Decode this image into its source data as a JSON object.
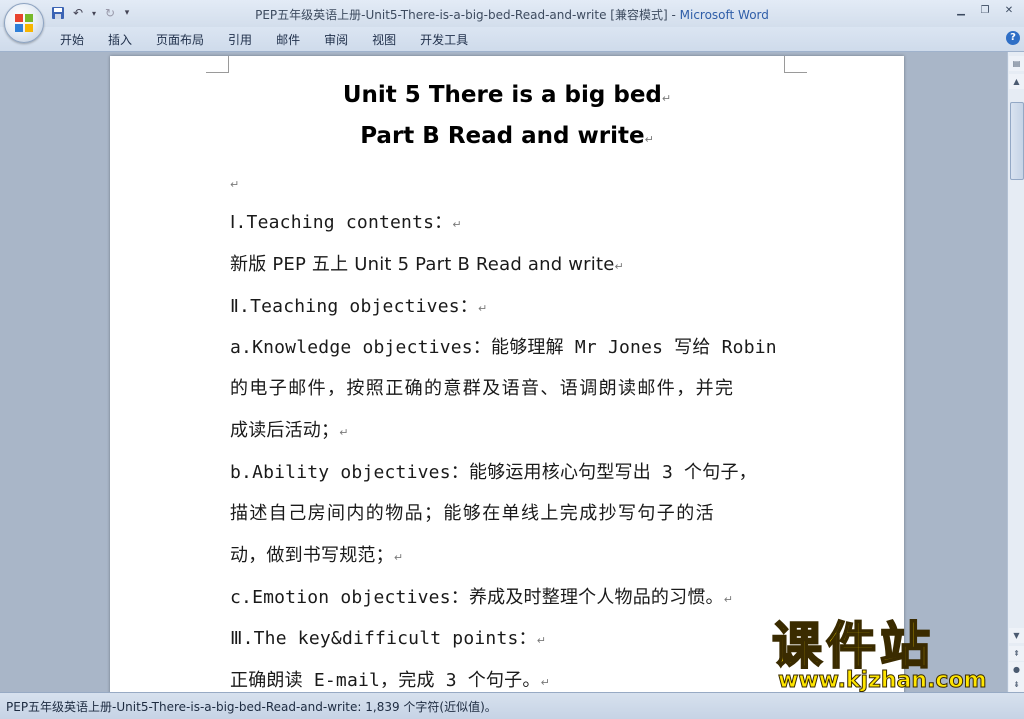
{
  "window": {
    "title": "PEP五年级英语上册-Unit5-There-is-a-big-bed-Read-and-write [兼容模式]",
    "title_separator": " - ",
    "app_name": "Microsoft Word",
    "min": "▁",
    "restore": "❐",
    "close": "✕"
  },
  "ribbon": {
    "tabs": [
      "开始",
      "插入",
      "页面布局",
      "引用",
      "邮件",
      "审阅",
      "视图",
      "开发工具"
    ],
    "help": "?"
  },
  "document": {
    "heading1": "Unit 5 There is a big bed",
    "heading2": "Part B Read and write",
    "para_mark": "↵",
    "lines": [
      "Ⅰ.Teaching contents：",
      "新版 PEP 五上  Unit 5 Part B Read and write",
      "Ⅱ.Teaching objectives：",
      "a.Knowledge objectives：能够理解 Mr Jones 写给 Robin",
      "的电子邮件，按照正确的意群及语音、语调朗读邮件，并完",
      "成读后活动；",
      "b.Ability objectives：能够运用核心句型写出 3 个句子，",
      "描述自己房间内的物品；能够在单线上完成抄写句子的活",
      "动，做到书写规范；",
      "c.Emotion objectives：养成及时整理个人物品的习惯。",
      "Ⅲ.The key&difficult points：",
      "正确朗读 E-mail，完成 3 个句子。"
    ]
  },
  "statusbar": {
    "text": "PEP五年级英语上册-Unit5-There-is-a-big-bed-Read-and-write: 1,839 个字符(近似值)。"
  },
  "watermark": {
    "brand": "课件站",
    "url": "www.kjzhan.com"
  },
  "colors": {
    "title_app": "#2f5ea8",
    "doc_background": "#a9b6c8",
    "watermark_fill": "#f5d400"
  }
}
